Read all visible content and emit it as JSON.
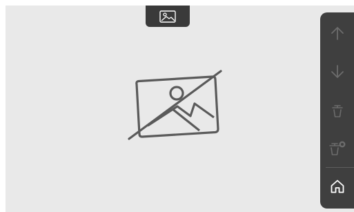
{
  "colors": {
    "background": "#e9e9e9",
    "panel": "#3f3f3f",
    "tab": "#3a3a3a",
    "icon_disabled": "#6c6c6c",
    "icon_active": "#ffffff",
    "placeholder_stroke": "#5a5a5a"
  },
  "top_tab": {
    "icon": "image-icon"
  },
  "main": {
    "placeholder_icon": "image-unavailable-icon"
  },
  "sidebar": {
    "buttons": [
      {
        "icon": "arrow-up-icon",
        "enabled": false
      },
      {
        "icon": "arrow-down-icon",
        "enabled": false
      },
      {
        "icon": "trash-icon",
        "enabled": false
      },
      {
        "icon": "trash-badge-icon",
        "enabled": false
      },
      {
        "icon": "home-icon",
        "enabled": true
      }
    ]
  }
}
